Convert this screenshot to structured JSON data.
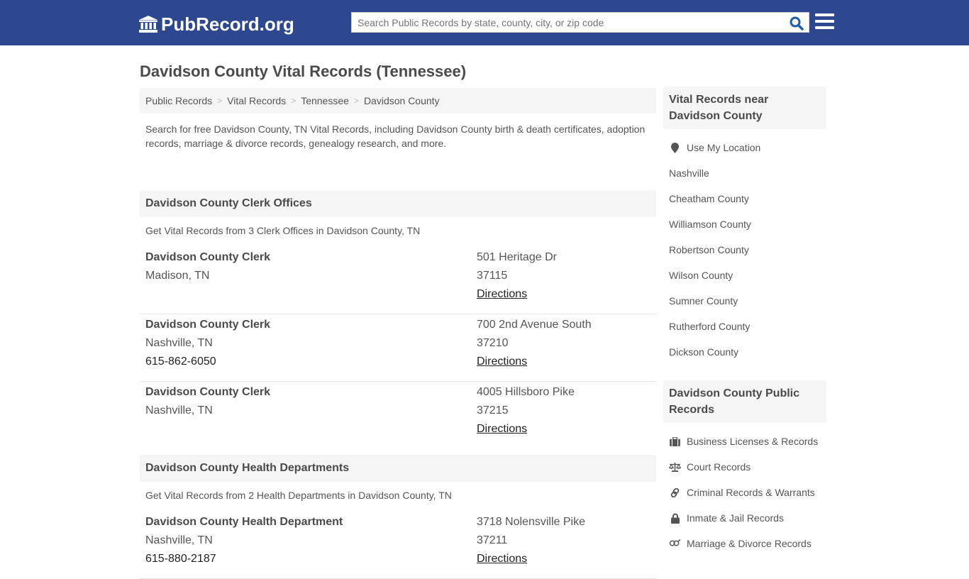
{
  "header": {
    "logo_text": "PubRecord.org",
    "search_placeholder": "Search Public Records by state, county, city, or zip code",
    "search_value": "",
    "brand_color": "#2e4890"
  },
  "page": {
    "title": "Davidson County Vital Records (Tennessee)"
  },
  "breadcrumb": [
    {
      "label": "Public Records"
    },
    {
      "label": "Vital Records"
    },
    {
      "label": "Tennessee"
    },
    {
      "label": "Davidson County"
    }
  ],
  "intro": "Search for free Davidson County, TN Vital Records, including Davidson County birth & death certificates, adoption records, marriage & divorce records, genealogy research, and more.",
  "sections": [
    {
      "title": "Davidson County Clerk Offices",
      "subtitle": "Get Vital Records from 3 Clerk Offices in Davidson County, TN",
      "entries": [
        {
          "name": "Davidson County Clerk",
          "city": "Madison, TN",
          "phone": "",
          "street": "501 Heritage Dr",
          "zip": "37115",
          "directions": "Directions"
        },
        {
          "name": "Davidson County Clerk",
          "city": "Nashville, TN",
          "phone": "615-862-6050",
          "street": "700 2nd Avenue South",
          "zip": "37210",
          "directions": "Directions"
        },
        {
          "name": "Davidson County Clerk",
          "city": "Nashville, TN",
          "phone": "",
          "street": "4005 Hillsboro Pike",
          "zip": "37215",
          "directions": "Directions"
        }
      ]
    },
    {
      "title": "Davidson County Health Departments",
      "subtitle": "Get Vital Records from 2 Health Departments in Davidson County, TN",
      "entries": [
        {
          "name": "Davidson County Health Department",
          "city": "Nashville, TN",
          "phone": "615-880-2187",
          "street": "3718 Nolensville Pike",
          "zip": "37211",
          "directions": "Directions"
        }
      ]
    }
  ],
  "sidebar": {
    "nearby": {
      "title": "Vital Records near Davidson County",
      "use_location": {
        "label": "Use My Location",
        "icon": "map-marker-icon"
      },
      "items": [
        {
          "label": "Nashville"
        },
        {
          "label": "Cheatham County"
        },
        {
          "label": "Williamson County"
        },
        {
          "label": "Robertson County"
        },
        {
          "label": "Wilson County"
        },
        {
          "label": "Sumner County"
        },
        {
          "label": "Rutherford County"
        },
        {
          "label": "Dickson County"
        }
      ]
    },
    "public_records": {
      "title": "Davidson County Public Records",
      "items": [
        {
          "label": "Business Licenses & Records",
          "icon": "briefcase-icon"
        },
        {
          "label": "Court Records",
          "icon": "balance-scale-icon"
        },
        {
          "label": "Criminal Records & Warrants",
          "icon": "link-icon"
        },
        {
          "label": "Inmate & Jail Records",
          "icon": "lock-icon"
        },
        {
          "label": "Marriage & Divorce Records",
          "icon": "venus-mars-icon"
        }
      ]
    }
  }
}
